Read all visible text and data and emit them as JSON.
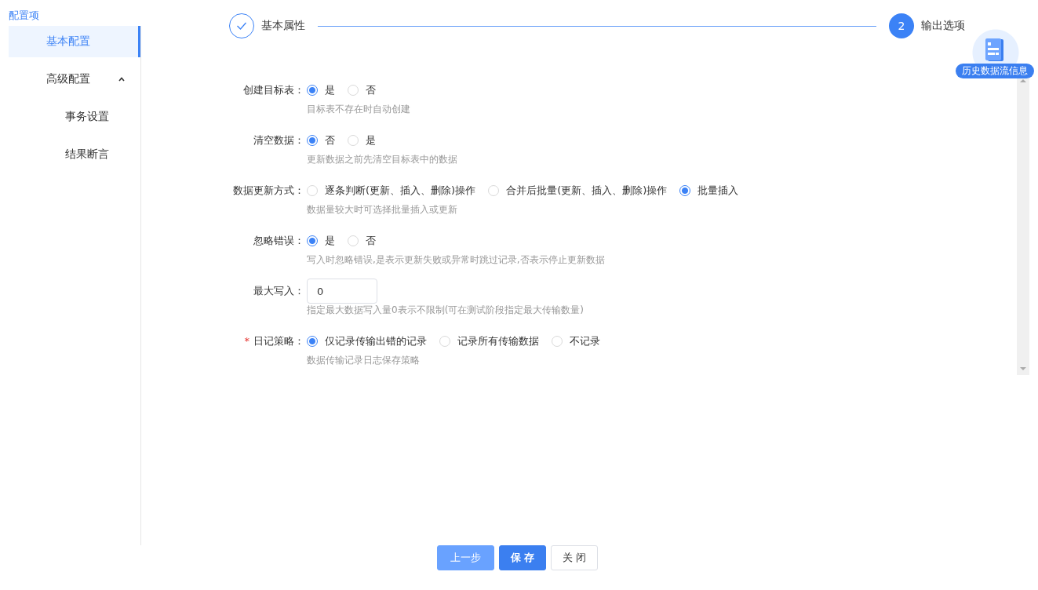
{
  "sidebar": {
    "title": "配置项",
    "items": [
      {
        "label": "基本配置",
        "selected": true
      },
      {
        "label": "高级配置",
        "selected": false,
        "expanded": true,
        "children": [
          {
            "label": "事务设置",
            "selected": false
          },
          {
            "label": "结果断言",
            "selected": false
          }
        ]
      }
    ]
  },
  "steps": [
    {
      "label": "基本属性",
      "completed": true
    },
    {
      "number": "2",
      "label": "输出选项",
      "completed": false
    }
  ],
  "history_badge": {
    "label": "历史数据流信息"
  },
  "form": [
    {
      "kind": "radio",
      "label": "创建目标表：",
      "options": [
        {
          "label": "是",
          "selected": true
        },
        {
          "label": "否",
          "selected": false
        }
      ],
      "hint": "目标表不存在时自动创建"
    },
    {
      "kind": "radio",
      "label": "清空数据：",
      "options": [
        {
          "label": "否",
          "selected": true
        },
        {
          "label": "是",
          "selected": false
        }
      ],
      "hint": "更新数据之前先清空目标表中的数据"
    },
    {
      "kind": "radio",
      "label": "数据更新方式：",
      "options": [
        {
          "label": "逐条判断(更新、插入、删除)操作",
          "selected": false
        },
        {
          "label": "合并后批量(更新、插入、删除)操作",
          "selected": false
        },
        {
          "label": "批量插入",
          "selected": true
        }
      ],
      "hint": "数据量较大时可选择批量插入或更新"
    },
    {
      "kind": "radio",
      "label": "忽略错误：",
      "options": [
        {
          "label": "是",
          "selected": true
        },
        {
          "label": "否",
          "selected": false
        }
      ],
      "hint": "写入时忽略错误,是表示更新失败或异常时跳过记录,否表示停止更新数据"
    },
    {
      "kind": "input",
      "label": "最大写入：",
      "value": "0",
      "hint": "指定最大数据写入量0表示不限制(可在测试阶段指定最大传输数量)"
    },
    {
      "kind": "radio",
      "required_mark": "*",
      "label": "日记策略：",
      "options": [
        {
          "label": "仅记录传输出错的记录",
          "selected": true
        },
        {
          "label": "记录所有传输数据",
          "selected": false
        },
        {
          "label": "不记录",
          "selected": false
        }
      ],
      "hint": "数据传输记录日志保存策略"
    }
  ],
  "buttons": [
    {
      "label": "上一步",
      "kind": "prev"
    },
    {
      "label": "保 存",
      "kind": "primary"
    },
    {
      "label": "关 闭",
      "kind": "plain"
    }
  ]
}
